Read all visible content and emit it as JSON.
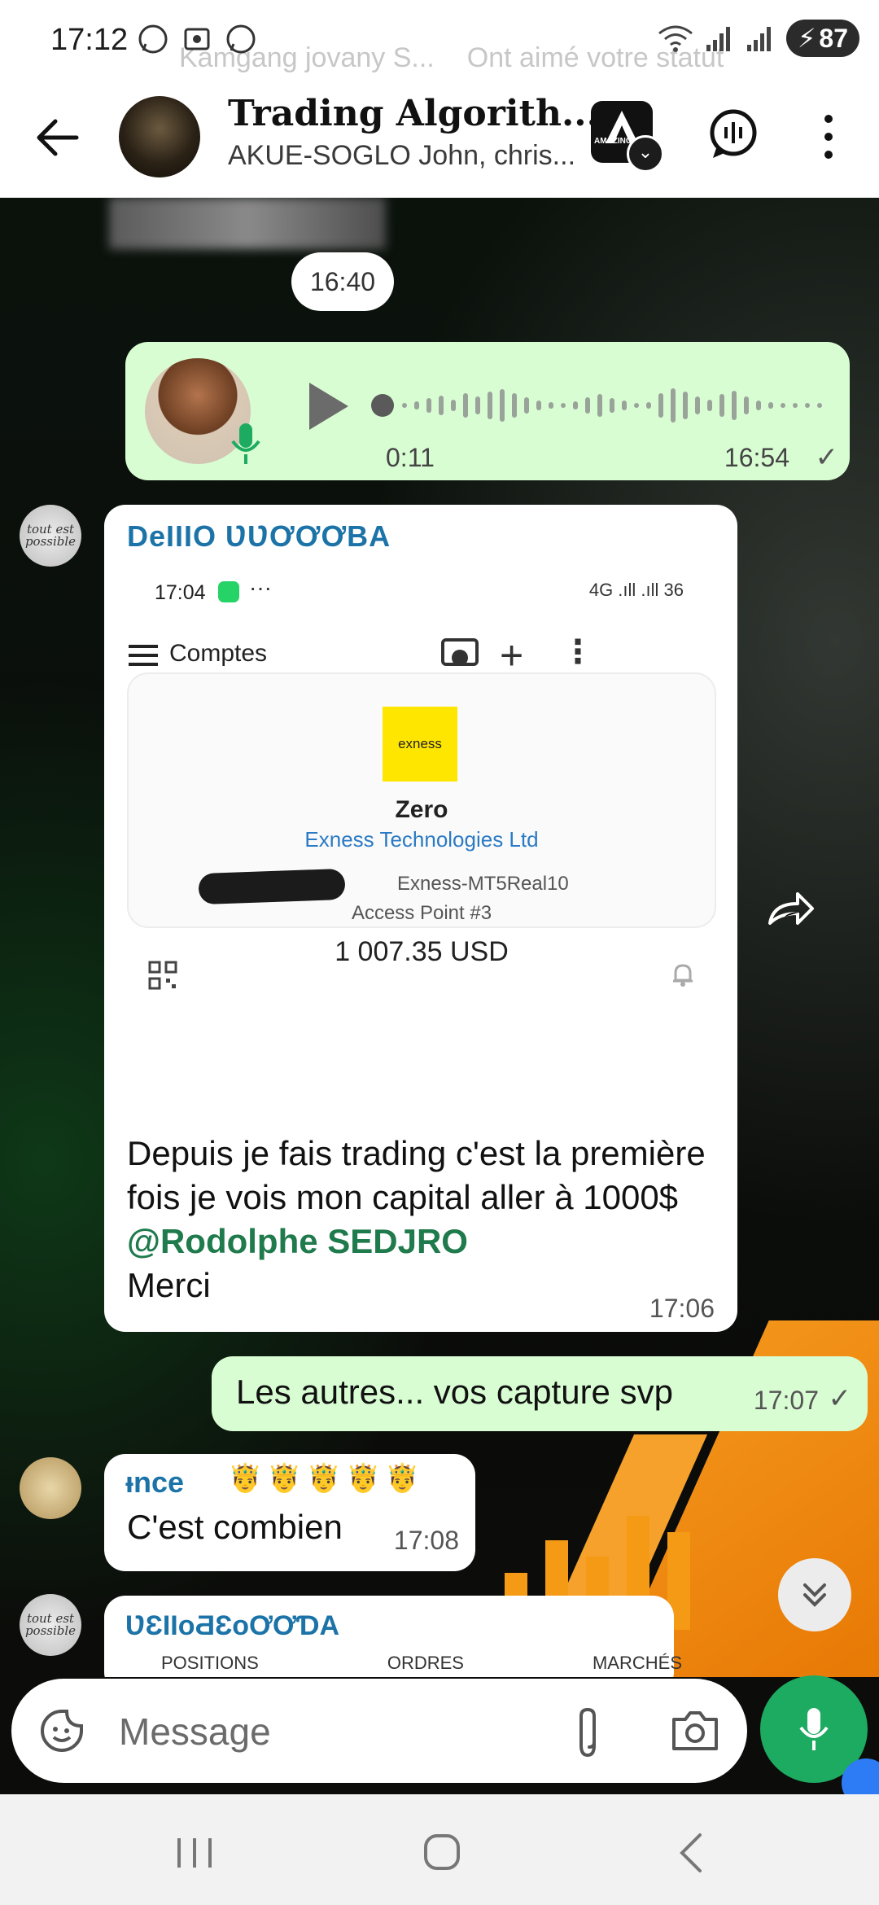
{
  "status_bar": {
    "time": "17:12",
    "battery": "87",
    "notification_sender": "Kamgang jovany S...",
    "notification_text": "Ont aimé votre statut"
  },
  "header": {
    "title": "Trading Algorith...",
    "subtitle": "AKUE-SOGLO John, chris...",
    "amazing_label": "AMAZING"
  },
  "chat": {
    "date_chip": "16:40",
    "voice_message": {
      "duration": "0:11",
      "time": "16:54"
    },
    "image_message": {
      "sender": "DeIIIO ƲƲƠƠƠBA",
      "screenshot": {
        "status_time": "17:04",
        "signal": "4G .ıll .ıll 36",
        "screen_title": "Comptes",
        "account_name": "Zero",
        "broker": "Exness Technologies Ltd",
        "logo_text": "exness",
        "server": "Exness-MT5Real10",
        "access_point": "Access Point #3",
        "balance": "1 007.35 USD"
      },
      "caption_text": "Depuis je fais trading c'est la première fois je vois mon capital aller à 1000$ ",
      "caption_mention": "@Rodolphe SEDJRO",
      "caption_tail": "Merci",
      "time": "17:06"
    },
    "outgoing_message": {
      "text": "Les autres... vos capture svp",
      "time": "17:07"
    },
    "prince_message": {
      "sender": "ᵻnce",
      "crowns": "🤴🤴🤴🤴🤴",
      "text": "C'est combien",
      "time": "17:08"
    },
    "partial_message": {
      "sender": "ƲƐƖƖᴏƋƐᴏƠƠƊA",
      "tabs": [
        "POSITIONS",
        "ORDRES",
        "MARCHÉS"
      ]
    },
    "avatar_text": "tout est possible"
  },
  "composer": {
    "placeholder": "Message"
  },
  "colors": {
    "outgoing_bubble": "#d9fdd3",
    "incoming_bubble": "#ffffff",
    "mic_button": "#1daa61",
    "mention": "#1f7a4c",
    "sender_name": "#1c73a8"
  }
}
